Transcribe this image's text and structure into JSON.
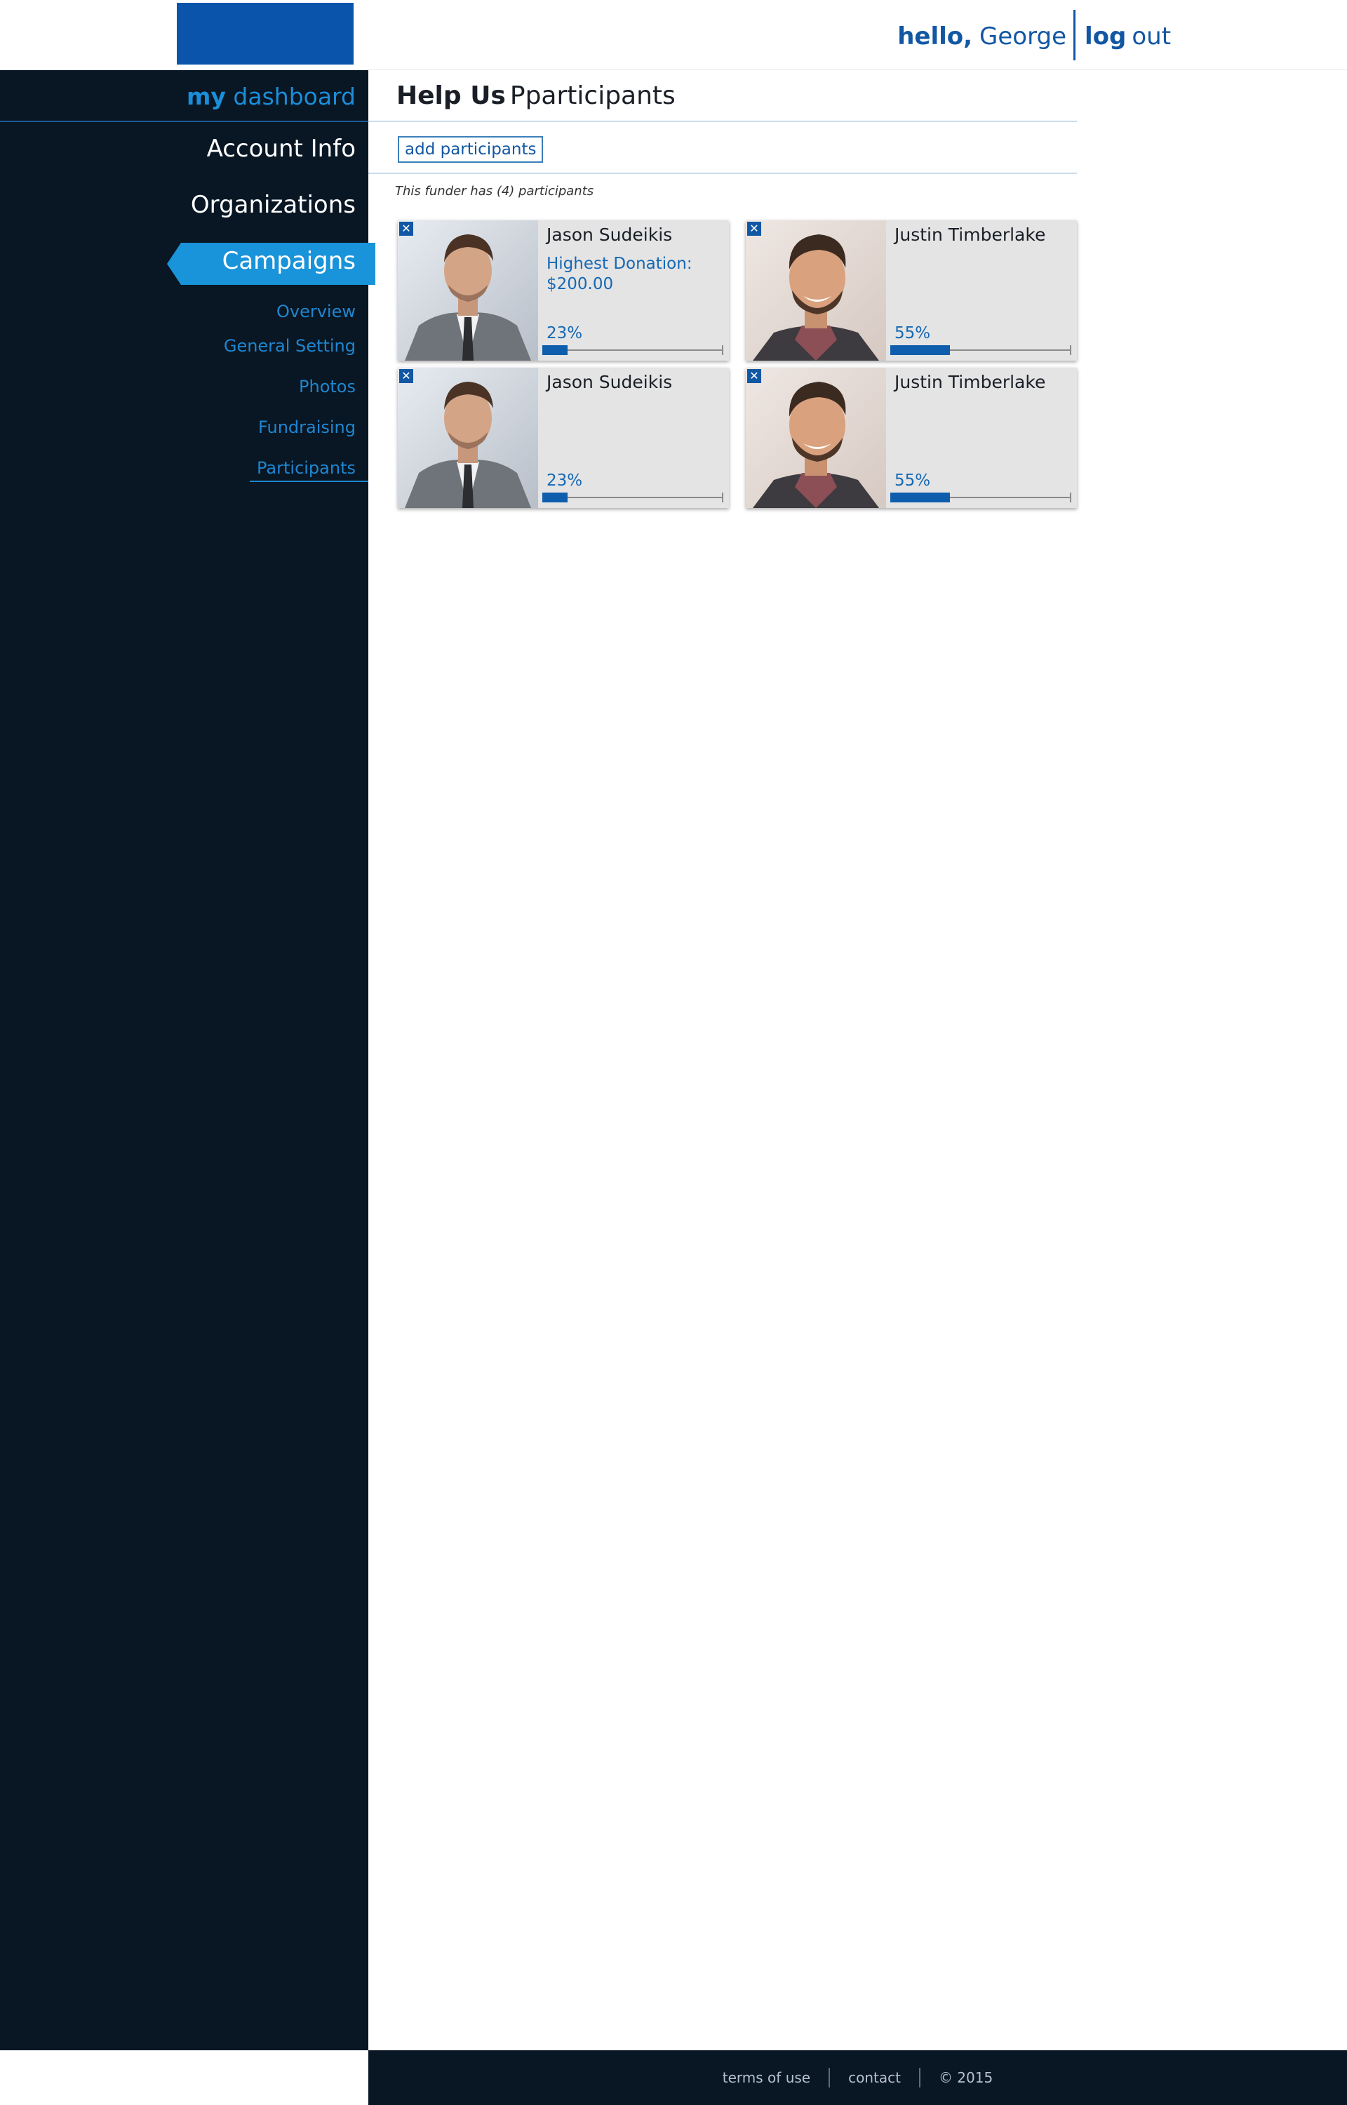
{
  "header": {
    "hello_label": "hello,",
    "user_name": "George",
    "logout_strong": "log",
    "logout_light": "out",
    "brand_color": "#0a55ab"
  },
  "sidebar": {
    "title_strong": "my",
    "title_light": "dashboard",
    "items": [
      {
        "label": "Account Info"
      },
      {
        "label": "Organizations"
      },
      {
        "label": "Campaigns",
        "active": true
      }
    ],
    "sub_items": [
      {
        "label": "Overview"
      },
      {
        "label": "General Setting"
      },
      {
        "label": "Photos"
      },
      {
        "label": "Fundraising"
      },
      {
        "label": "Participants",
        "current": true
      }
    ],
    "background": "#091623",
    "accent": "#1993d9"
  },
  "main": {
    "title_strong": "Help Us",
    "title_light": "Pparticipants",
    "add_button_label": "add participants",
    "count_text": "This funder has (4) participants"
  },
  "participants": [
    {
      "name": "Jason Sudeikis",
      "donation_label": "Highest Donation:",
      "donation_value": "$200.00",
      "percent_label": "23%",
      "progress": 23,
      "remove_glyph": "✕"
    },
    {
      "name": "Justin Timberlake",
      "donation_label": "",
      "donation_value": "",
      "percent_label": "55%",
      "progress": 55,
      "remove_glyph": "✕"
    },
    {
      "name": "Jason Sudeikis",
      "donation_label": "",
      "donation_value": "",
      "percent_label": "23%",
      "progress": 23,
      "remove_glyph": "✕"
    },
    {
      "name": "Justin Timberlake",
      "donation_label": "",
      "donation_value": "",
      "percent_label": "55%",
      "progress": 55,
      "remove_glyph": "✕"
    }
  ],
  "footer": {
    "terms_label": "terms of use",
    "contact_label": "contact",
    "copyright": "© 2015"
  }
}
